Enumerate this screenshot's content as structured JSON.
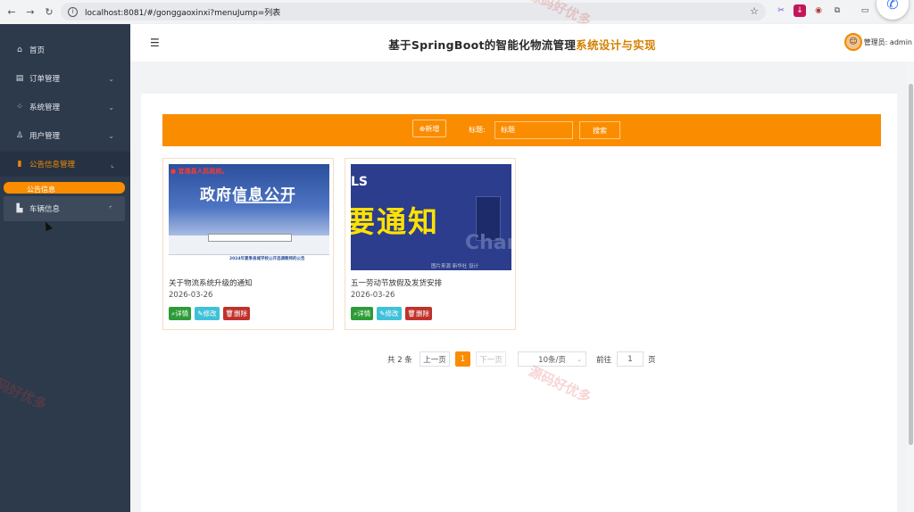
{
  "browser": {
    "url": "localhost:8081/#/gonggaoxinxi?menuJump=列表",
    "back_icon": "arrow-left",
    "forward_icon": "arrow-right",
    "reload_icon": "reload"
  },
  "header": {
    "title_part1": "基于SpringBoot的智能化物流管理",
    "title_part2": "系统设计与实现",
    "user_label": "管理员: admin"
  },
  "sidebar": {
    "items": [
      {
        "label": "首页",
        "icon": "home-icon"
      },
      {
        "label": "订单管理",
        "icon": "doc-icon"
      },
      {
        "label": "系统管理",
        "icon": "grid-icon"
      },
      {
        "label": "用户管理",
        "icon": "user-icon"
      },
      {
        "label": "公告信息管理",
        "icon": "notice-icon"
      },
      {
        "label": "车辆信息",
        "icon": "dashboard-icon"
      }
    ],
    "sub_item": "公告信息"
  },
  "toolbar": {
    "add_label": "⊕新增",
    "title_label": "标题:",
    "title_placeholder": "标题",
    "search_label": "搜索"
  },
  "cards": [
    {
      "title": "关于物流系统升级的通知",
      "date": "2026-03-26",
      "image": {
        "red_text": "● 宜港县人民政府。",
        "heading": "政府信息公开",
        "caption": "2024年夏季县城学校公开选调教师的公告"
      }
    },
    {
      "title": "五一劳动节放假及发货安排",
      "date": "2026-03-26",
      "image": {
        "corner_text": "LS",
        "heading": "要通知",
        "brand": "Chan",
        "caption": "图片来源 新华社 设计"
      }
    }
  ],
  "card_buttons": {
    "detail": "详情",
    "edit": "修改",
    "delete": "删除"
  },
  "pagination": {
    "total": "共 2 条",
    "prev": "上一页",
    "current": "1",
    "next": "下一页",
    "page_size": "10条/页",
    "goto": "前往",
    "goto_value": "1",
    "page_suffix": "页"
  },
  "watermark": "源码好优多",
  "colors": {
    "accent": "#fa8c00",
    "sidebar": "#2d3a4b",
    "detail": "#2e9b38",
    "edit": "#3fc1d8",
    "delete": "#c0322b"
  }
}
